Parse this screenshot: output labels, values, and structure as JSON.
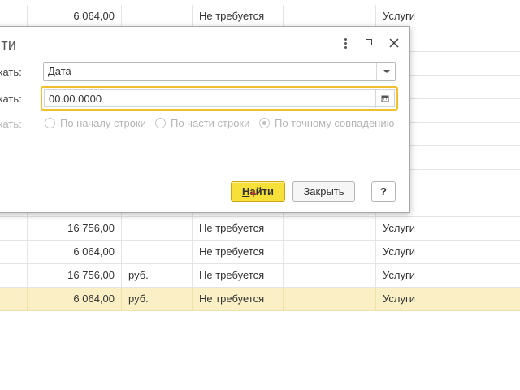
{
  "table": {
    "rows": [
      {
        "sum": "6 064,00",
        "currency": "",
        "vat": "Не требуется",
        "kind": "Услуги",
        "selected": false
      },
      {
        "sum": "",
        "currency": "",
        "vat": "",
        "kind": "",
        "selected": false
      },
      {
        "sum": "",
        "currency": "",
        "vat": "",
        "kind": "",
        "selected": false
      },
      {
        "sum": "",
        "currency": "",
        "vat": "",
        "kind": "",
        "selected": false
      },
      {
        "sum": "",
        "currency": "",
        "vat": "",
        "kind": "",
        "selected": false
      },
      {
        "sum": "",
        "currency": "",
        "vat": "",
        "kind": "",
        "selected": false
      },
      {
        "sum": "",
        "currency": "",
        "vat": "",
        "kind": "",
        "selected": false
      },
      {
        "sum": "",
        "currency": "",
        "vat": "",
        "kind": "",
        "selected": false
      },
      {
        "sum": "",
        "currency": "",
        "vat": "",
        "kind": "",
        "selected": false
      },
      {
        "sum": "16 756,00",
        "currency": "",
        "vat": "Не требуется",
        "kind": "Услуги",
        "selected": false
      },
      {
        "sum": "6 064,00",
        "currency": "",
        "vat": "Не требуется",
        "kind": "Услуги",
        "selected": false
      },
      {
        "sum": "16 756,00",
        "currency": "руб.",
        "vat": "Не требуется",
        "kind": "Услуги",
        "selected": false
      },
      {
        "sum": "6 064,00",
        "currency": "руб.",
        "vat": "Не требуется",
        "kind": "Услуги",
        "selected": true
      }
    ]
  },
  "dialog": {
    "title": "йти",
    "where_label": "скать:",
    "where_value": "Дата",
    "what_label": "скать:",
    "what_value": "00.00.0000",
    "how_label": "скать:",
    "options": [
      {
        "label": "По началу строки",
        "checked": false
      },
      {
        "label": "По части строки",
        "checked": false
      },
      {
        "label": "По точному совпадению",
        "checked": true
      }
    ],
    "find_button": {
      "underlined": "Н",
      "rest": "айти"
    },
    "close_button": "Закрыть",
    "help_button": "?"
  },
  "icons": {
    "more": "more-vertical-icon",
    "maximize": "maximize-icon",
    "close": "close-icon",
    "dropdown": "chevron-down-icon",
    "calendar": "calendar-icon"
  },
  "colors": {
    "selected_row": "#fbf0c5",
    "focus_border": "#f0c12c",
    "primary_button": "#f7e03a"
  }
}
